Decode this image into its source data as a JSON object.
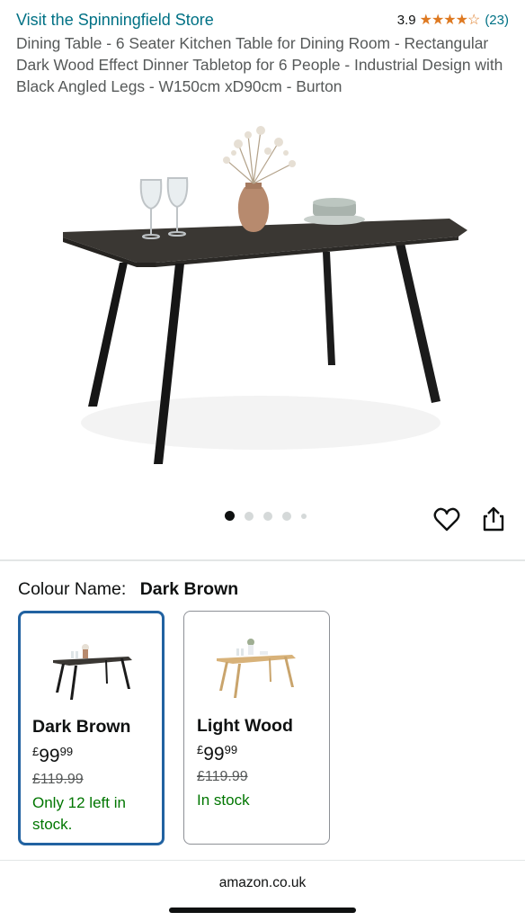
{
  "store": {
    "link": "Visit the Spinningfield Store"
  },
  "rating": {
    "value": "3.9",
    "stars": "★★★★☆",
    "count": "(23)"
  },
  "product": {
    "title": "Dining Table - 6 Seater Kitchen Table for Dining Room - Rectangular Dark Wood Effect Dinner Tabletop for 6 People - Industrial Design with Black Angled Legs - W150cm xD90cm - Burton"
  },
  "gallery": {
    "image_count": 5,
    "active_index": 0
  },
  "colour": {
    "label": "Colour Name:",
    "selected": "Dark Brown"
  },
  "variants": [
    {
      "name": "Dark Brown",
      "currency": "£",
      "whole": "99",
      "fraction": "99",
      "was": "£119.99",
      "availability": "Only 12 left in stock.",
      "selected": true
    },
    {
      "name": "Light Wood",
      "currency": "£",
      "whole": "99",
      "fraction": "99",
      "was": "£119.99",
      "availability": "In stock",
      "selected": false
    }
  ],
  "footer": {
    "domain": "amazon.co.uk"
  },
  "colors": {
    "link": "#007185",
    "star": "#de7921",
    "selected_border": "#2162a1",
    "in_stock": "#007600"
  }
}
